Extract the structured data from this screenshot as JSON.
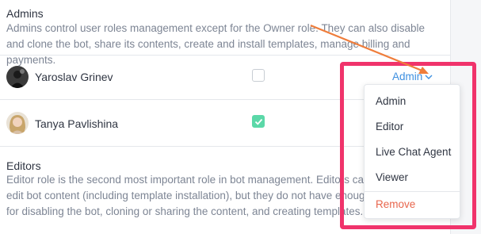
{
  "admins": {
    "title": "Admins",
    "description": "Admins control user roles management except for the Owner role. They can also disable and clone the bot, share its contents, create and install templates, manage billing and payments."
  },
  "users": [
    {
      "name": "Yaroslav Grinev",
      "checked": false,
      "role": "Admin"
    },
    {
      "name": "Tanya Pavlishina",
      "checked": true
    }
  ],
  "role_menu": {
    "items": [
      "Admin",
      "Editor",
      "Live Chat Agent",
      "Viewer"
    ],
    "remove_label": "Remove"
  },
  "editors": {
    "title": "Editors",
    "description": "Editor role is the second most important role in bot management. Editors can create and edit bot content (including template installation), but they do not have enough permissions for disabling the bot, cloning or sharing the content, and creating templates."
  },
  "colors": {
    "link": "#3d8fe0",
    "check": "#5bd8a8",
    "danger": "#e8654c",
    "highlight": "#f0336b",
    "arrow": "#ef7d3b"
  }
}
